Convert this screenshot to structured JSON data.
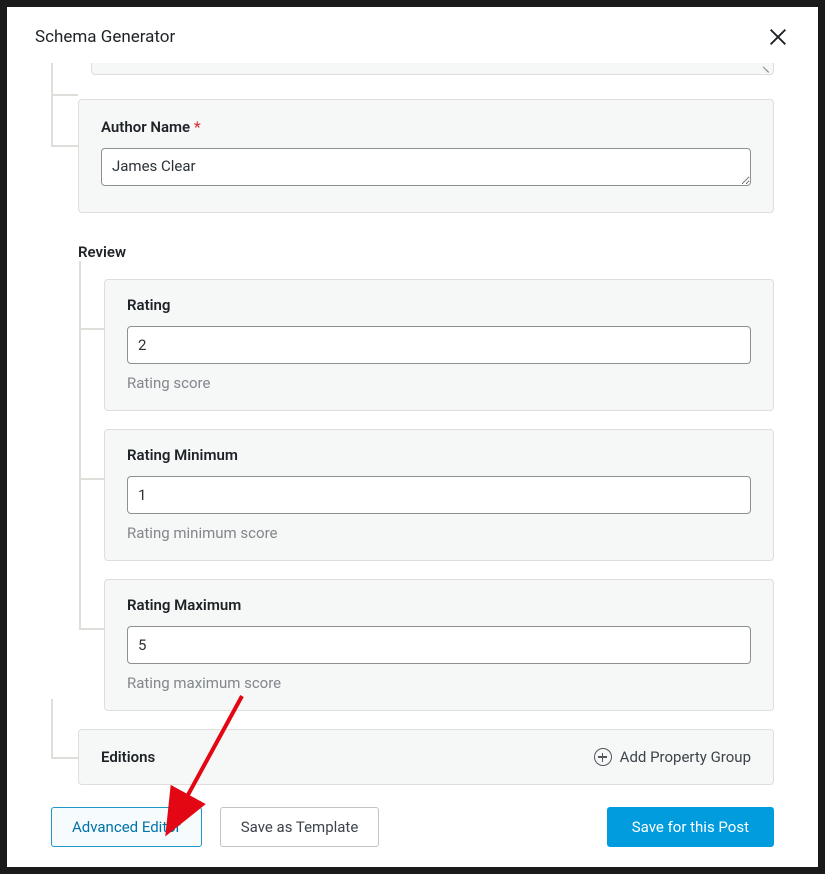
{
  "modal": {
    "title": "Schema Generator"
  },
  "author": {
    "label": "Author Name",
    "required_marker": "*",
    "value": "James Clear"
  },
  "review": {
    "heading": "Review",
    "rating": {
      "label": "Rating",
      "value": "2",
      "helper": "Rating score"
    },
    "rating_min": {
      "label": "Rating Minimum",
      "value": "1",
      "helper": "Rating minimum score"
    },
    "rating_max": {
      "label": "Rating Maximum",
      "value": "5",
      "helper": "Rating maximum score"
    }
  },
  "editions": {
    "title": "Editions",
    "add_label": "Add Property Group"
  },
  "buttons": {
    "advanced": "Advanced Editor",
    "save_template": "Save as Template",
    "save_post": "Save for this Post"
  },
  "colors": {
    "accent": "#009cde",
    "required": "#d63638",
    "arrow": "#e30613"
  }
}
